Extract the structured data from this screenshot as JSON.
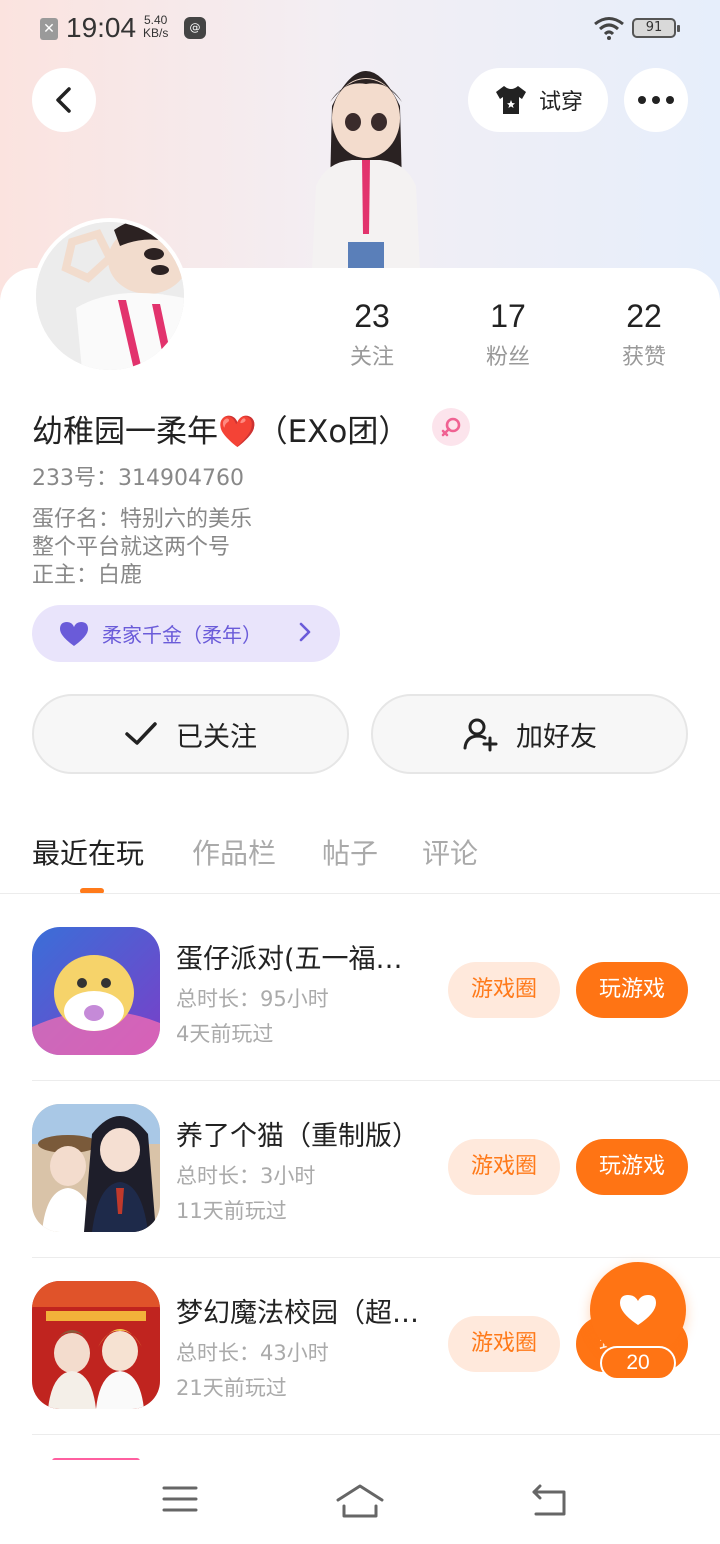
{
  "status_bar": {
    "time": "19:04",
    "net_speed_value": "5.40",
    "net_speed_unit": "KB/s",
    "battery": "91"
  },
  "header": {
    "try_on_label": "试穿"
  },
  "stats": [
    {
      "value": "23",
      "label": "关注"
    },
    {
      "value": "17",
      "label": "粉丝"
    },
    {
      "value": "22",
      "label": "获赞"
    }
  ],
  "profile": {
    "name": "幼稚园一柔年❤️（EXo团）",
    "uid": "233号：314904760",
    "bio": [
      "蛋仔名：特别六的美乐",
      "整个平台就这两个号",
      "正主：白鹿"
    ],
    "fan_badge": "柔家千金（柔年）"
  },
  "actions": {
    "follow_label": "已关注",
    "add_friend_label": "加好友"
  },
  "tabs": [
    "最近在玩",
    "作品栏",
    "帖子",
    "评论"
  ],
  "games": [
    {
      "title": "蛋仔派对(五一福利版)",
      "duration": "总时长：95小时",
      "last_played": "4天前玩过",
      "circle_label": "游戏圈",
      "play_label": "玩游戏"
    },
    {
      "title": "养了个猫（重制版）",
      "duration": "总时长：3小时",
      "last_played": "11天前玩过",
      "circle_label": "游戏圈",
      "play_label": "玩游戏"
    },
    {
      "title": "梦幻魔法校园（超级版）",
      "duration": "总时长：43小时",
      "last_played": "21天前玩过",
      "circle_label": "游戏圈",
      "play_label": "玩游戏"
    }
  ],
  "like_fab": {
    "count": "20"
  },
  "colors": {
    "accent": "#ff7414",
    "accent_light": "#ffe9dc",
    "badge_bg": "#e9e4fb",
    "badge_fg": "#6a5bd9"
  }
}
